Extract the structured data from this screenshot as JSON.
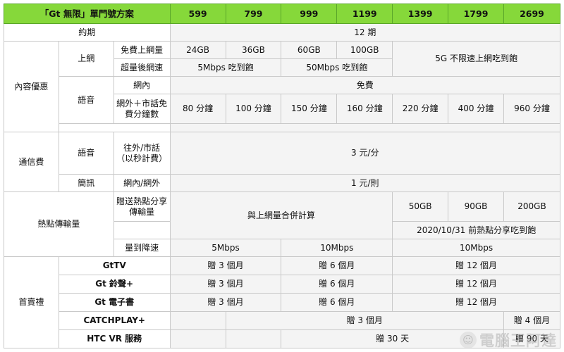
{
  "header": {
    "title": "「Gt 無限」單門號方案",
    "prices": [
      "599",
      "799",
      "999",
      "1199",
      "1399",
      "1799",
      "2699"
    ]
  },
  "contract": {
    "label": "約期",
    "value": "12 期"
  },
  "content": {
    "label": "內容優惠",
    "internet": {
      "label": "上網",
      "free_label": "免費上網量",
      "free_values": [
        "24GB",
        "36GB",
        "60GB",
        "100GB"
      ],
      "unlimited": "5G 不限速上網吃到飽",
      "after_label": "超量後網速",
      "after_values": [
        "5Mbps 吃到飽",
        "50Mbps 吃到飽"
      ]
    },
    "voice": {
      "label": "語音",
      "onnet_label": "網內",
      "onnet_value": "免費",
      "offnet_label": "網外＋市話免費分鐘數",
      "offnet_values": [
        "80 分鐘",
        "100 分鐘",
        "150 分鐘",
        "160 分鐘",
        "220 分鐘",
        "400 分鐘",
        "960 分鐘"
      ]
    }
  },
  "fees": {
    "label": "通信費",
    "voice_label": "語音",
    "voice_sub": "往外/市話（以秒計費）",
    "voice_value": "3 元/分",
    "sms_label": "簡訊",
    "sms_sub": "網內/網外",
    "sms_value": "1 元/則"
  },
  "hotspot": {
    "label": "熱點傳輸量",
    "gift_label": "贈送熱點分享傳輸量",
    "merged": "與上網量合併計算",
    "values": [
      "50GB",
      "90GB",
      "200GB"
    ],
    "promo": "2020/10/31 前熱點分享吃到飽",
    "throttle_label": "量到降速",
    "throttle_values": [
      "5Mbps",
      "10Mbps",
      "10Mbps"
    ]
  },
  "gifts": {
    "label": "首賣禮",
    "gttv": {
      "label": "GtTV",
      "values": [
        "贈 3 個月",
        "贈 6 個月",
        "贈 12 個月"
      ]
    },
    "ring": {
      "label": "Gt 鈴聲+",
      "values": [
        "贈 3 個月",
        "贈 6 個月",
        "贈 12 個月"
      ]
    },
    "ebook": {
      "label": "Gt 電子書",
      "values": [
        "贈 3 個月",
        "贈 6 個月",
        "贈 12 個月"
      ]
    },
    "catchplay": {
      "label": "CATCHPLAY+",
      "values": [
        "贈 3 個月",
        "贈 4 個月"
      ]
    },
    "htcvr": {
      "label": "HTC VR 服務",
      "values": [
        "贈 30 天",
        "贈 90 天"
      ]
    }
  },
  "watermark": {
    "text": "電腦王阿達",
    "icon": "mascot-face-icon"
  },
  "colors": {
    "header_bg": "#86d83a",
    "value_bg": "#f4f4f4",
    "border": "#c9c9c9"
  }
}
